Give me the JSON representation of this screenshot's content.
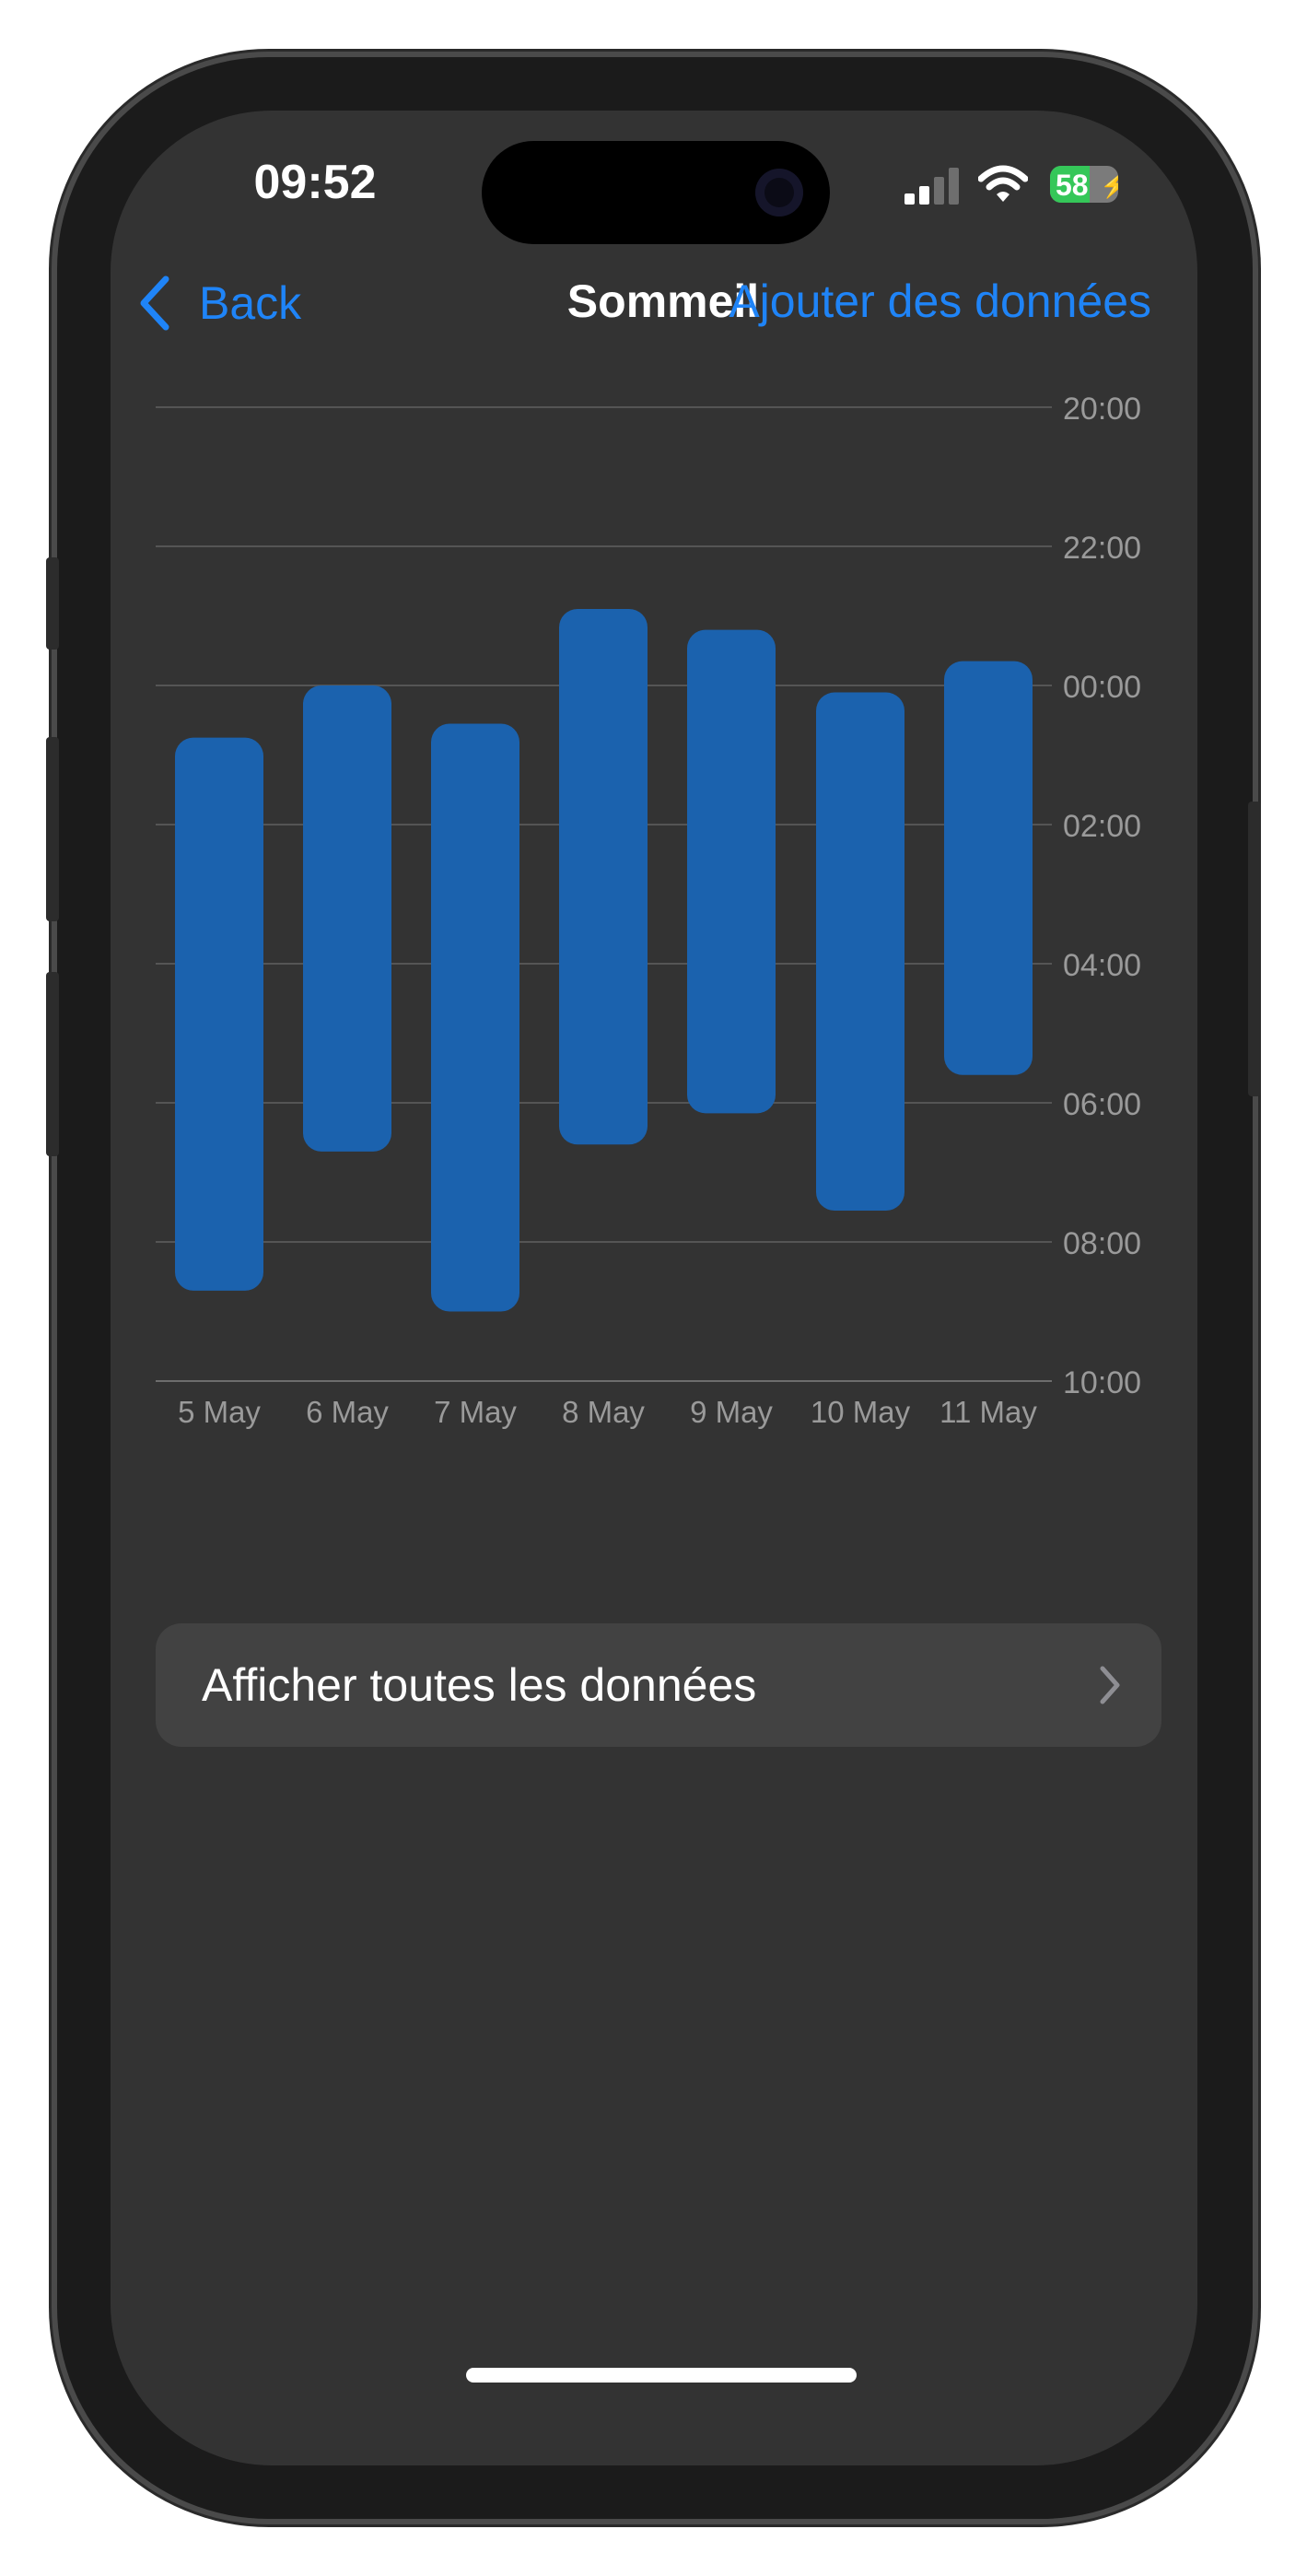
{
  "status_bar": {
    "time": "09:52",
    "battery_level": "58",
    "battery_percent": 0.58,
    "signal_bars": 2
  },
  "nav": {
    "back_label": "Back",
    "title": "Sommeil",
    "action_label": "Ajouter des données"
  },
  "chart_data": {
    "type": "bar",
    "categories": [
      "5 May",
      "6 May",
      "7 May",
      "8 May",
      "9 May",
      "10 May",
      "11 May"
    ],
    "y_ticks": [
      "20:00",
      "22:00",
      "00:00",
      "02:00",
      "04:00",
      "06:00",
      "08:00",
      "10:00"
    ],
    "series": [
      {
        "start": [
          0.75,
          0.0,
          0.55,
          -1.1,
          -0.8,
          0.1,
          -0.35
        ],
        "end": [
          8.7,
          6.7,
          9.0,
          6.6,
          6.15,
          7.55,
          5.6
        ]
      }
    ],
    "ylim": [
      -4,
      10
    ],
    "y_inverted": true,
    "grid": true,
    "bar_color": "#1b62ae"
  },
  "actions": {
    "show_all_label": "Afficher toutes les données"
  },
  "colors": {
    "accent": "#1f84f7",
    "background": "#333333",
    "card": "#424242"
  }
}
